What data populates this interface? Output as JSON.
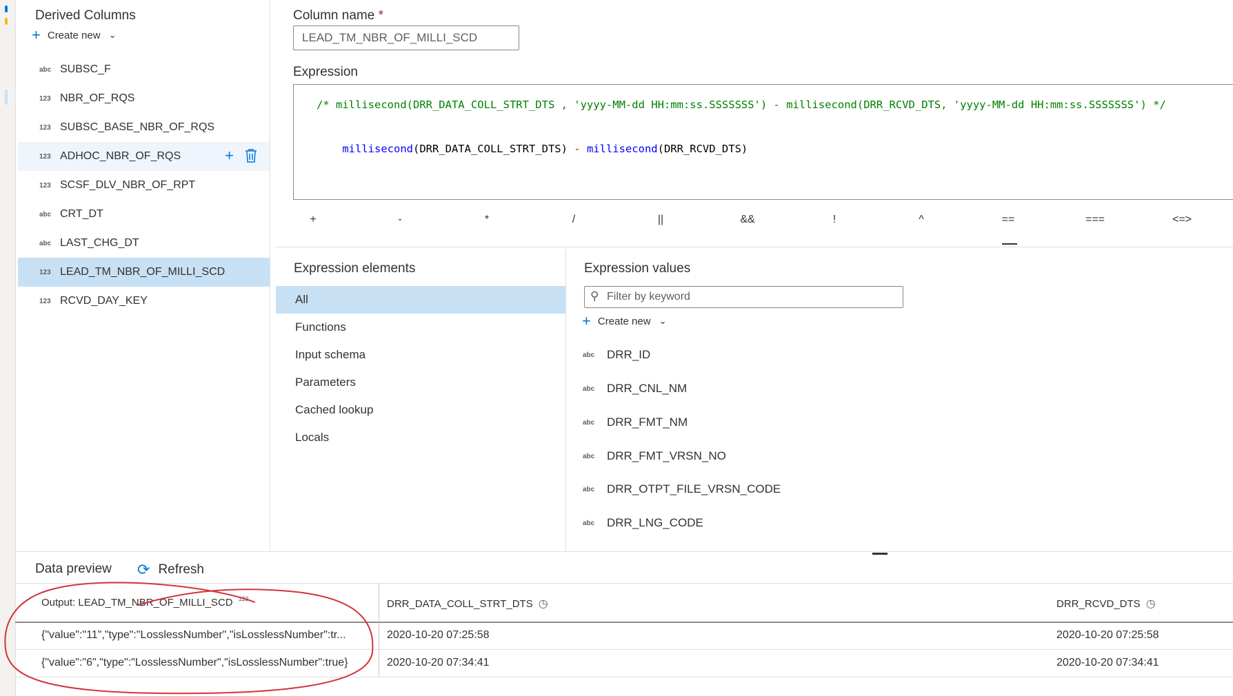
{
  "derived_panel": {
    "title": "Derived Columns",
    "create_new_label": "Create new",
    "columns": [
      {
        "type": "abc",
        "name": "SUBSC_F"
      },
      {
        "type": "123",
        "name": "NBR_OF_RQS"
      },
      {
        "type": "123",
        "name": "SUBSC_BASE_NBR_OF_RQS"
      },
      {
        "type": "123",
        "name": "ADHOC_NBR_OF_RQS"
      },
      {
        "type": "123",
        "name": "SCSF_DLV_NBR_OF_RPT"
      },
      {
        "type": "abc",
        "name": "CRT_DT"
      },
      {
        "type": "abc",
        "name": "LAST_CHG_DT"
      },
      {
        "type": "123",
        "name": "LEAD_TM_NBR_OF_MILLI_SCD"
      },
      {
        "type": "123",
        "name": "RCVD_DAY_KEY"
      }
    ]
  },
  "column_name": {
    "label": "Column name",
    "required_mark": "*",
    "value": "LEAD_TM_NBR_OF_MILLI_SCD"
  },
  "expression": {
    "label": "Expression",
    "comment_line": "/* millisecond(DRR_DATA_COLL_STRT_DTS , 'yyyy-MM-dd HH:mm:ss.SSSSSSS') - millisecond(DRR_RCVD_DTS, 'yyyy-MM-dd HH:mm:ss.SSSSSSS') */",
    "code_fn1": "millisecond",
    "code_arg1": "(DRR_DATA_COLL_STRT_DTS)",
    "code_op": " - ",
    "code_fn2": "millisecond",
    "code_arg2": "(DRR_RCVD_DTS)"
  },
  "operators": [
    "+",
    "-",
    "*",
    "/",
    "||",
    "&&",
    "!",
    "^",
    "==",
    "===",
    "<=>"
  ],
  "expression_elements": {
    "title": "Expression elements",
    "items": [
      "All",
      "Functions",
      "Input schema",
      "Parameters",
      "Cached lookup",
      "Locals"
    ]
  },
  "expression_values": {
    "title": "Expression values",
    "filter_placeholder": "Filter by keyword",
    "create_new_label": "Create new",
    "items": [
      {
        "type": "abc",
        "name": "DRR_ID"
      },
      {
        "type": "abc",
        "name": "DRR_CNL_NM"
      },
      {
        "type": "abc",
        "name": "DRR_FMT_NM"
      },
      {
        "type": "abc",
        "name": "DRR_FMT_VRSN_NO"
      },
      {
        "type": "abc",
        "name": "DRR_OTPT_FILE_VRSN_CODE"
      },
      {
        "type": "abc",
        "name": "DRR_LNG_CODE"
      }
    ]
  },
  "data_preview": {
    "title": "Data preview",
    "refresh_label": "Refresh",
    "columns": [
      {
        "label": "Output: LEAD_TM_NBR_OF_MILLI_SCD",
        "type": "123"
      },
      {
        "label": "DRR_DATA_COLL_STRT_DTS"
      },
      {
        "label": "DRR_RCVD_DTS"
      }
    ],
    "rows": [
      [
        "{\"value\":\"11\",\"type\":\"LosslessNumber\",\"isLosslessNumber\":tr...",
        "2020-10-20 07:25:58",
        "2020-10-20 07:25:58"
      ],
      [
        "{\"value\":\"6\",\"type\":\"LosslessNumber\",\"isLosslessNumber\":true}",
        "2020-10-20 07:34:41",
        "2020-10-20 07:34:41"
      ]
    ]
  },
  "colors": {
    "accent": "#0078d4",
    "selected_bg": "#c7e0f4",
    "annotation": "#d13438",
    "comment": "#008000",
    "keyword": "#0000ff"
  }
}
